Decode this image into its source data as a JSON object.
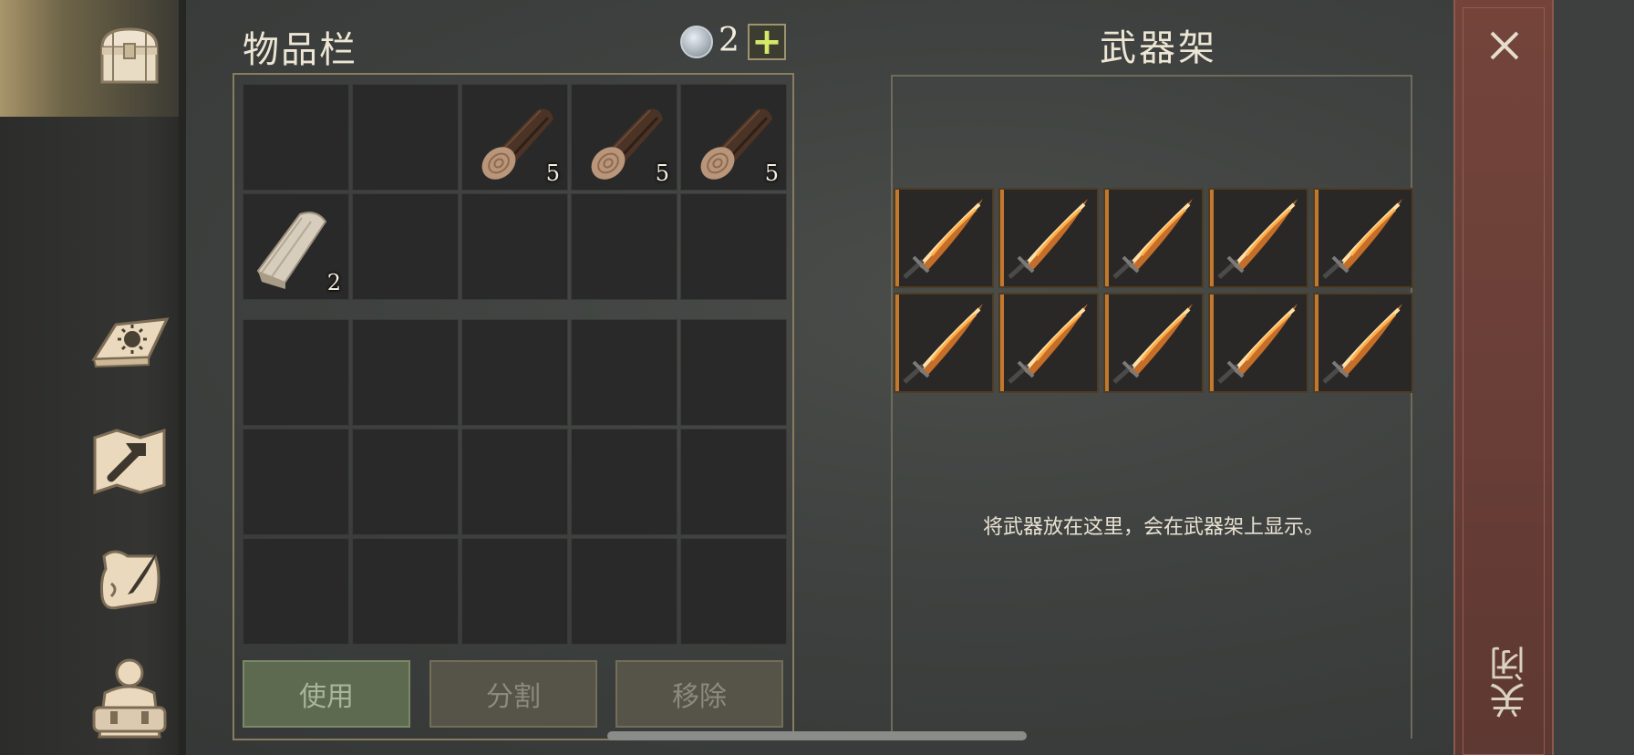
{
  "colors": {
    "accent_gold": "#a8956a",
    "close_red": "#6a3f37",
    "use_green": "#5d6a4f",
    "slot_bg": "#292929",
    "rack_orange": "#c2782d"
  },
  "sidebar": {
    "items": [
      {
        "icon": "chest-icon",
        "active": true
      },
      {
        "icon": "sun-book-icon",
        "active": false
      },
      {
        "icon": "map-hammer-icon",
        "active": false
      },
      {
        "icon": "scroll-quill-icon",
        "active": false
      },
      {
        "icon": "character-backpack-icon",
        "active": false
      }
    ]
  },
  "inventory": {
    "title": "物品栏",
    "currency": {
      "icon": "silver-coin-icon",
      "count": "2",
      "plus_label": "+"
    },
    "top_grid": [
      {
        "item": null,
        "count": ""
      },
      {
        "item": null,
        "count": ""
      },
      {
        "item": "wood-log-icon",
        "count": "5"
      },
      {
        "item": "wood-log-icon",
        "count": "5"
      },
      {
        "item": "wood-log-icon",
        "count": "5"
      },
      {
        "item": "wood-plank-icon",
        "count": "2"
      },
      {
        "item": null,
        "count": ""
      },
      {
        "item": null,
        "count": ""
      },
      {
        "item": null,
        "count": ""
      },
      {
        "item": null,
        "count": ""
      }
    ],
    "bottom_grid_slots": 15,
    "buttons": {
      "use": "使用",
      "split": "分割",
      "remove": "移除"
    }
  },
  "weapon_rack": {
    "title": "武器架",
    "slots": [
      "flaming-sword-icon",
      "flaming-sword-icon",
      "flaming-sword-icon",
      "flaming-sword-icon",
      "flaming-sword-icon",
      "flaming-sword-icon",
      "flaming-sword-icon",
      "flaming-sword-icon",
      "flaming-sword-icon",
      "flaming-sword-icon"
    ],
    "hint": "将武器放在这里，会在武器架上显示。"
  },
  "close_panel": {
    "label": "关闭",
    "icon": "close-icon"
  }
}
